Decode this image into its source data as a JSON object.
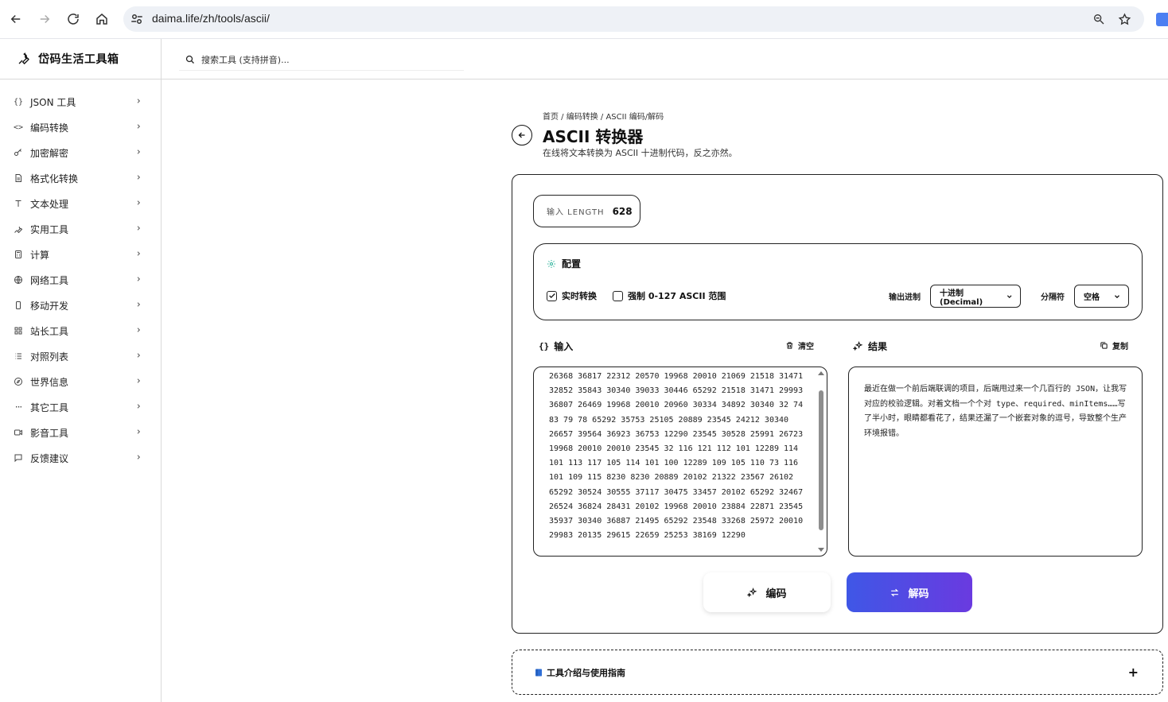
{
  "browser": {
    "url": "daima.life/zh/tools/ascii/"
  },
  "brand": {
    "name": "岱码生活工具箱"
  },
  "search": {
    "placeholder": "搜索工具 (支持拼音)..."
  },
  "sidebar": {
    "items": [
      {
        "label": "JSON 工具",
        "icon": "braces-icon"
      },
      {
        "label": "编码转换",
        "icon": "code-icon"
      },
      {
        "label": "加密解密",
        "icon": "key-icon"
      },
      {
        "label": "格式化转换",
        "icon": "document-icon"
      },
      {
        "label": "文本处理",
        "icon": "text-icon"
      },
      {
        "label": "实用工具",
        "icon": "wrench-icon"
      },
      {
        "label": "计算",
        "icon": "calculator-icon"
      },
      {
        "label": "网络工具",
        "icon": "globe-icon"
      },
      {
        "label": "移动开发",
        "icon": "phone-icon"
      },
      {
        "label": "站长工具",
        "icon": "grid-icon"
      },
      {
        "label": "对照列表",
        "icon": "list-icon"
      },
      {
        "label": "世界信息",
        "icon": "compass-icon"
      },
      {
        "label": "其它工具",
        "icon": "more-icon"
      },
      {
        "label": "影音工具",
        "icon": "video-icon"
      },
      {
        "label": "反馈建议",
        "icon": "message-icon"
      }
    ]
  },
  "page": {
    "breadcrumb": "首页 / 编码转换 / ASCII 编码/解码",
    "title": "ASCII 转换器",
    "subtitle": "在线将文本转换为 ASCII 十进制代码，反之亦然。"
  },
  "stats": {
    "length_label": "输入 LENGTH",
    "length_value": "628"
  },
  "config": {
    "title": "配置",
    "realtime_label": "实时转换",
    "realtime_checked": true,
    "force_range_label": "强制 0-127 ASCII 范围",
    "force_range_checked": false,
    "base_label": "输出进制",
    "base_value": "十进制 (Decimal)",
    "sep_label": "分隔符",
    "sep_value": "空格"
  },
  "input": {
    "title": "输入",
    "clear_label": "清空",
    "text": "26368 36817 22312 20570 19968 20010 21069 21518 31471 32852 35843 30340 39033 30446 65292 21518 31471 29993 36807 26469 19968 20010 20960 30334 34892 30340 32 74 83 79 78 65292 35753 25105 20889 23545 24212 30340 26657 39564 36923 36753 12290 23545 30528 25991 26723 19968 20010 20010 23545 32 116 121 112 101 12289 114 101 113 117 105 114 101 100 12289 109 105 110 73 116 101 109 115 8230 8230 20889 20102 21322 23567 26102 65292 30524 30555 37117 30475 33457 20102 65292 32467 26524 36824 28431 20102 19968 20010 23884 22871 23545 35937 30340 36887 21495 65292 23548 33268 25972 20010 29983 20135 29615 22659 25253 38169 12290"
  },
  "output": {
    "title": "结果",
    "copy_label": "复制",
    "text": "最近在做一个前后端联调的项目，后端甩过来一个几百行的 JSON，让我写对应的校验逻辑。对着文档一个个对 type、required、minItems……写了半小时，眼睛都看花了，结果还漏了一个嵌套对象的逗号，导致整个生产环境报错。"
  },
  "actions": {
    "encode_label": "编码",
    "decode_label": "解码"
  },
  "guide": {
    "title": "工具介绍与使用指南",
    "toggle": "+"
  },
  "colors": {
    "accent_start": "#3f57e6",
    "accent_end": "#6a3ae0",
    "config_icon": "#2bb39a"
  }
}
